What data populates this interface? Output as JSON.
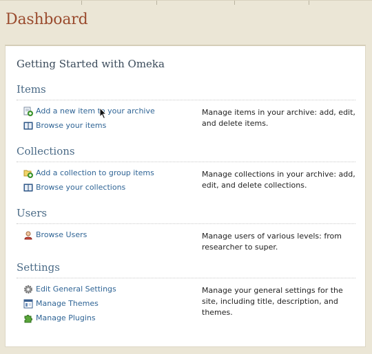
{
  "page": {
    "title": "Dashboard"
  },
  "panel": {
    "title": "Getting Started with Omeka"
  },
  "sections": {
    "items": {
      "heading": "Items",
      "links": [
        {
          "label": "Add a new item to your archive",
          "icon": "add-item-icon"
        },
        {
          "label": "Browse your items",
          "icon": "book-icon"
        }
      ],
      "description": "Manage items in your archive: add, edit, and delete items."
    },
    "collections": {
      "heading": "Collections",
      "links": [
        {
          "label": "Add a collection to group items",
          "icon": "add-folder-icon"
        },
        {
          "label": "Browse your collections",
          "icon": "book-icon"
        }
      ],
      "description": "Manage collections in your archive: add, edit, and delete collections."
    },
    "users": {
      "heading": "Users",
      "links": [
        {
          "label": "Browse Users",
          "icon": "user-icon"
        }
      ],
      "description": "Manage users of various levels: from researcher to super."
    },
    "settings": {
      "heading": "Settings",
      "links": [
        {
          "label": "Edit General Settings",
          "icon": "gear-icon"
        },
        {
          "label": "Manage Themes",
          "icon": "theme-icon"
        },
        {
          "label": "Manage Plugins",
          "icon": "puzzle-icon"
        }
      ],
      "description": "Manage your general settings for the site, including title, description, and themes."
    }
  },
  "colors": {
    "background": "#ebe6d6",
    "title": "#9a4b2e",
    "heading": "#4a6a86",
    "link": "#2f6495"
  }
}
